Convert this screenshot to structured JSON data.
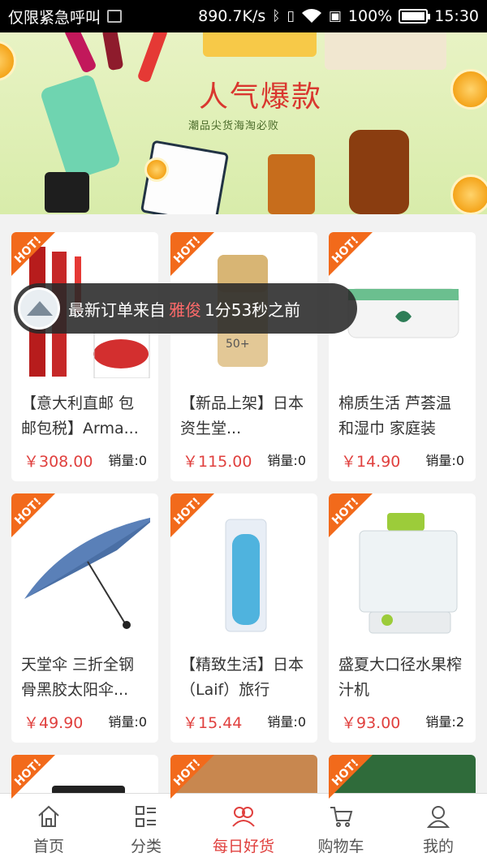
{
  "status_bar": {
    "carrier": "仅限紧急呼叫",
    "speed": "890.7K/s",
    "battery": "100%",
    "battery_level": 1.0,
    "time": "15:30"
  },
  "banner": {
    "title": "人气爆款",
    "subtitle": "潮品尖货海淘必败"
  },
  "toast": {
    "prefix": "最新订单来自",
    "name": "雅俊",
    "suffix": "1分53秒之前"
  },
  "hot_label": "HOT!",
  "products": [
    {
      "name": "【意大利直邮 包邮包税】Arma...",
      "price": "￥308.00",
      "sales": "销量:0",
      "icon": "lipstick"
    },
    {
      "name": "【新品上架】日本资生堂...",
      "price": "￥115.00",
      "sales": "销量:0",
      "icon": "sunscreen"
    },
    {
      "name": "棉质生活 芦荟温和湿巾 家庭装",
      "price": "￥14.90",
      "sales": "销量:0",
      "icon": "wet-wipes"
    },
    {
      "name": "天堂伞 三折全钢骨黑胶太阳伞...",
      "price": "￥49.90",
      "sales": "销量:0",
      "icon": "umbrella"
    },
    {
      "name": "【精致生活】日本（Laif）旅行",
      "price": "￥15.44",
      "sales": "销量:0",
      "icon": "toothbrush-case"
    },
    {
      "name": "盛夏大口径水果榨汁机",
      "price": "￥93.00",
      "sales": "销量:2",
      "icon": "juicer"
    }
  ],
  "tabs": [
    {
      "label": "首页",
      "icon": "home-icon",
      "active": false
    },
    {
      "label": "分类",
      "icon": "category-icon",
      "active": false
    },
    {
      "label": "每日好货",
      "icon": "daily-goods-icon",
      "active": true
    },
    {
      "label": "购物车",
      "icon": "cart-icon",
      "active": false
    },
    {
      "label": "我的",
      "icon": "profile-icon",
      "active": false
    }
  ],
  "colors": {
    "accent": "#e0403e",
    "hot_badge": "#f26a1b",
    "banner_bg": "#e2efbb"
  }
}
